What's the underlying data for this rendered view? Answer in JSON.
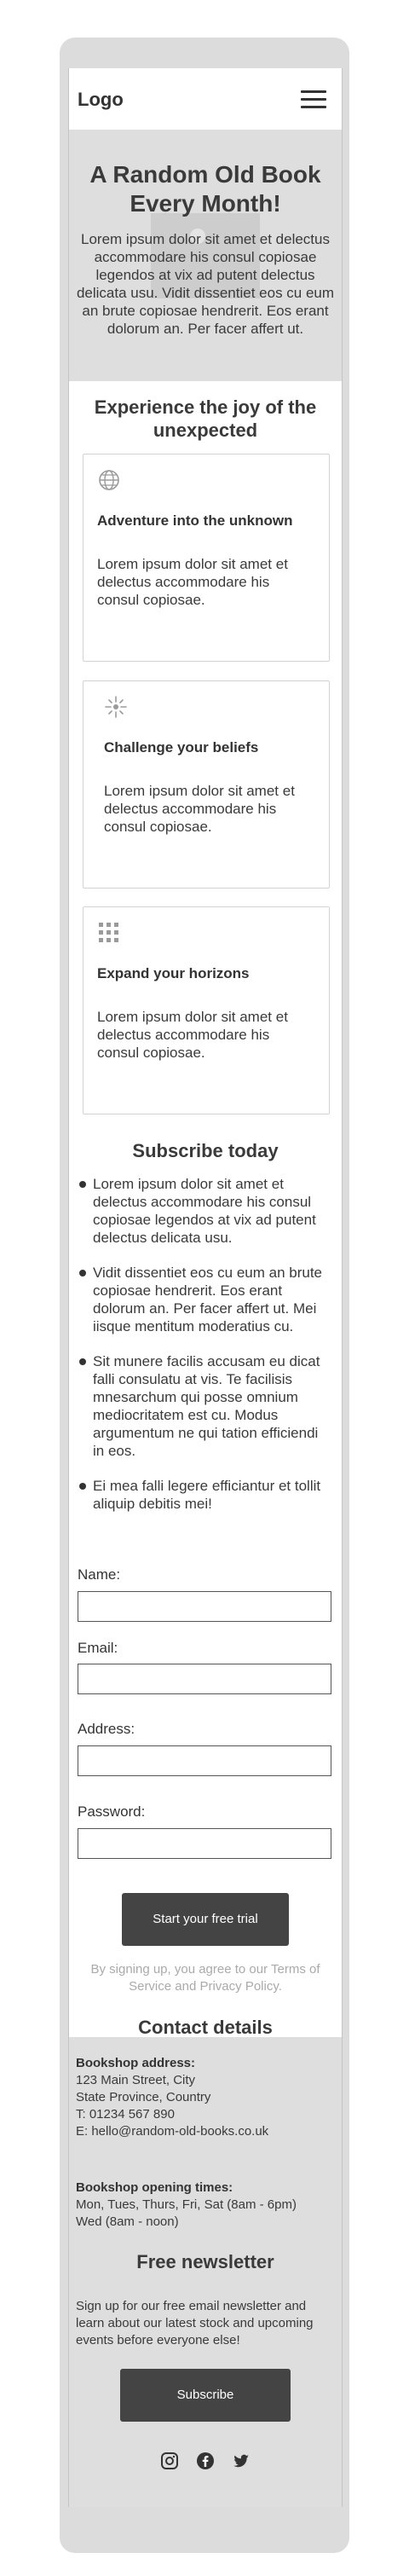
{
  "header": {
    "logo": "Logo",
    "menu_icon": "hamburger-menu-icon"
  },
  "hero": {
    "title": "A Random Old Book Every Month!",
    "text": "Lorem ipsum dolor sit amet et delectus accommodare his consul copiosae legendos at vix ad putent delectus delicata usu. Vidit dissentiet eos cu eum an brute copiosae hendrerit. Eos erant dolorum an. Per facer affert ut.",
    "image_icon": "placeholder-image-icon"
  },
  "features": {
    "title": "Experience the joy of the unexpected",
    "cards": [
      {
        "icon": "globe-icon",
        "title": "Adventure into the unknown",
        "text": "Lorem ipsum dolor sit amet et delectus accommodare his consul copiosae."
      },
      {
        "icon": "sparkle-icon",
        "title": "Challenge your beliefs",
        "text": "Lorem ipsum dolor sit amet et delectus accommodare his consul copiosae."
      },
      {
        "icon": "grid-icon",
        "title": "Expand your horizons",
        "text": "Lorem ipsum dolor sit amet et delectus accommodare his consul copiosae."
      }
    ]
  },
  "subscribe": {
    "title": "Subscribe today",
    "benefits": [
      "Lorem ipsum dolor sit amet et delectus accommodare his consul copiosae legendos at vix ad putent delectus delicata usu.",
      "Vidit dissentiet eos cu eum an brute copiosae hendrerit. Eos erant dolorum an. Per facer affert ut. Mei iisque mentitum moderatius cu.",
      "Sit munere facilis accusam eu dicat falli consulatu at vis. Te facilisis mnesarchum qui posse omnium mediocritatem est cu. Modus argumentum ne qui tation efficiendi in eos.",
      "Ei mea falli legere efficiantur et tollit aliquip debitis mei!"
    ],
    "fields": [
      {
        "label": "Name:"
      },
      {
        "label": "Email:"
      },
      {
        "label": "Address:"
      },
      {
        "label": "Password:"
      }
    ],
    "button": "Start your free trial",
    "legal": "By signing up, you agree to our Terms of Service and Privacy Policy."
  },
  "contact": {
    "title": "Contact details",
    "address_heading": "Bookshop address:",
    "address_lines": [
      "123 Main Street, City",
      "State Province, Country",
      "T: 01234 567 890",
      "E: hello@random-old-books.co.uk"
    ],
    "hours_heading": "Bookshop opening times:",
    "hours_lines": [
      "Mon, Tues, Thurs, Fri, Sat (8am - 6pm)",
      "Wed (8am - noon)"
    ]
  },
  "newsletter": {
    "title": "Free newsletter",
    "text": "Sign up for our free email newsletter and learn about our latest stock and upcoming events before everyone else!",
    "button": "Subscribe"
  },
  "social": [
    "instagram-icon",
    "facebook-icon",
    "twitter-icon"
  ],
  "colors": {
    "button": "#444444",
    "hero_bg": "#dedede",
    "frame": "#dcdcdc",
    "muted_text": "#aaaaaa"
  }
}
